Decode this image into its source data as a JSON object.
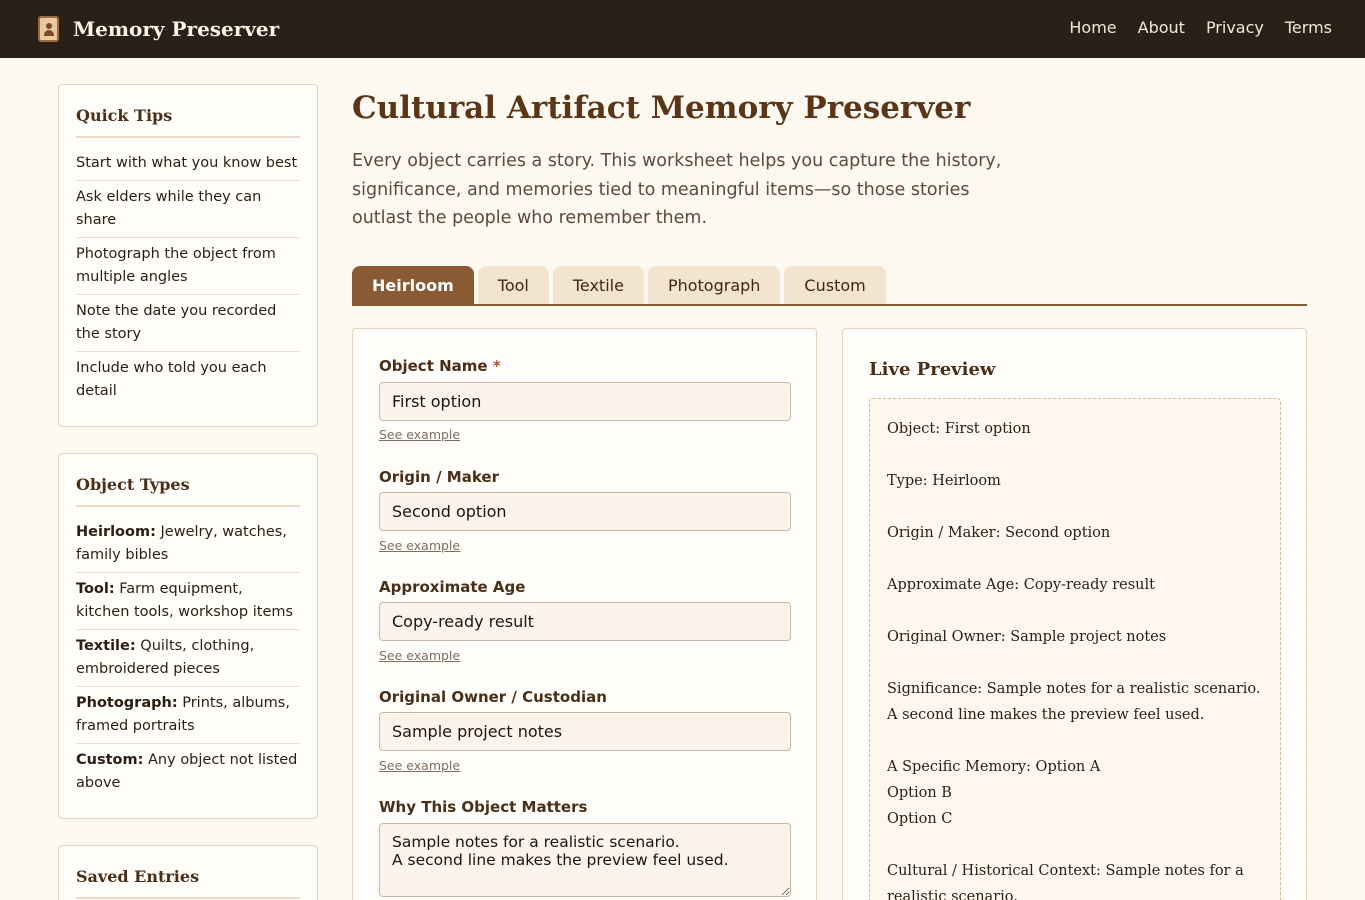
{
  "app": {
    "title": "Memory Preserver",
    "icon": "portrait-frame-icon"
  },
  "nav": {
    "items": [
      "Home",
      "About",
      "Privacy",
      "Terms"
    ]
  },
  "quick_tips": {
    "heading": "Quick Tips",
    "items": [
      "Start with what you know best",
      "Ask elders while they can share",
      "Photograph the object from multiple angles",
      "Note the date you recorded the story",
      "Include who told you each detail"
    ]
  },
  "object_types": {
    "heading": "Object Types",
    "items": [
      {
        "name": "Heirloom:",
        "desc": "Jewelry, watches, family bibles"
      },
      {
        "name": "Tool:",
        "desc": "Farm equipment, kitchen tools, workshop items"
      },
      {
        "name": "Textile:",
        "desc": "Quilts, clothing, embroidered pieces"
      },
      {
        "name": "Photograph:",
        "desc": "Prints, albums, framed portraits"
      },
      {
        "name": "Custom:",
        "desc": "Any object not listed above"
      }
    ]
  },
  "saved_entries": {
    "heading": "Saved Entries"
  },
  "main": {
    "title": "Cultural Artifact Memory Preserver",
    "intro": "Every object carries a story. This worksheet helps you capture the history, significance, and memories tied to meaningful items—so those stories outlast the people who remember them.",
    "tabs": [
      "Heirloom",
      "Tool",
      "Textile",
      "Photograph",
      "Custom"
    ],
    "active_tab": "Heirloom"
  },
  "form": {
    "required_marker": "*",
    "example_link": "See example",
    "object_name": {
      "label": "Object Name",
      "value": "First option"
    },
    "origin": {
      "label": "Origin / Maker",
      "value": "Second option"
    },
    "age": {
      "label": "Approximate Age",
      "value": "Copy-ready result"
    },
    "owner": {
      "label": "Original Owner / Custodian",
      "value": "Sample project notes"
    },
    "matters": {
      "label": "Why This Object Matters",
      "value": "Sample notes for a realistic scenario.\nA second line makes the preview feel used."
    }
  },
  "preview": {
    "heading": "Live Preview",
    "lines": [
      "Object: First option",
      "Type: Heirloom",
      "Origin / Maker: Second option",
      "Approximate Age: Copy-ready result",
      "Original Owner: Sample project notes",
      "Significance: Sample notes for a realistic scenario.",
      "A second line makes the preview feel used.",
      "A Specific Memory: Option A",
      "Option B",
      "Option C",
      "Cultural / Historical Context: Sample notes for a realistic scenario."
    ]
  },
  "colors": {
    "header_bg": "#2b2017",
    "accent": "#8a5a34",
    "page_bg": "#fdf8f0"
  }
}
